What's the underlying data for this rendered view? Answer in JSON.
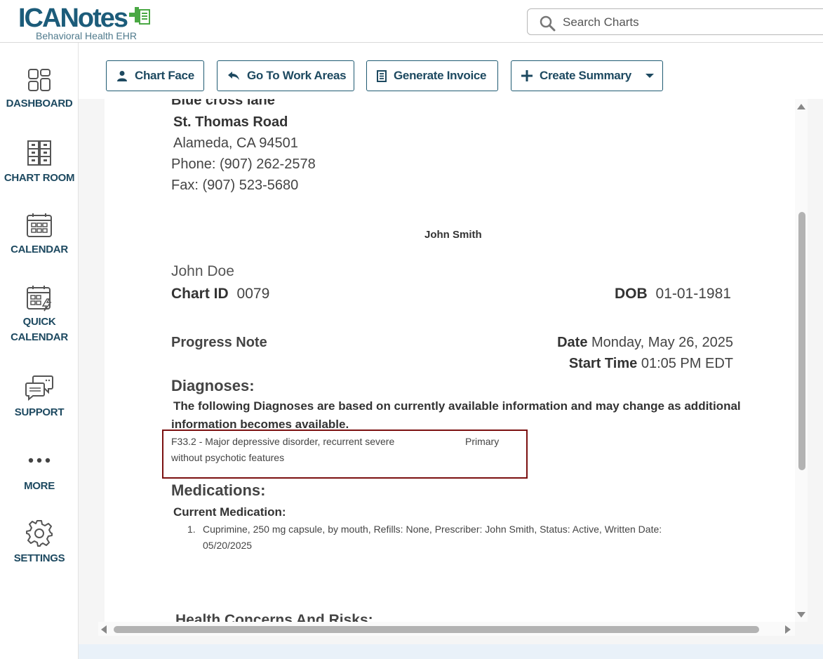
{
  "header": {
    "logo_main": "ICANotes",
    "logo_sub": "Behavioral Health EHR",
    "search_placeholder": "Search Charts"
  },
  "sidebar": {
    "items": [
      {
        "label": "DASHBOARD",
        "icon": "dashboard-icon"
      },
      {
        "label": "CHART ROOM",
        "icon": "chart-room-icon"
      },
      {
        "label": "CALENDAR",
        "icon": "calendar-icon"
      },
      {
        "label": "QUICK",
        "label2": "CALENDAR",
        "icon": "quick-calendar-icon"
      },
      {
        "label": "SUPPORT",
        "icon": "support-icon"
      },
      {
        "label": "MORE",
        "icon": "more-icon"
      },
      {
        "label": "SETTINGS",
        "icon": "gear-icon"
      }
    ]
  },
  "toolbar": {
    "chart_face": "Chart Face",
    "go_to_work_areas": "Go To Work Areas",
    "generate_invoice": "Generate Invoice",
    "create_summary": "Create Summary"
  },
  "document": {
    "clinic_name_partial": "Blue cross lane",
    "address_line1": "St. Thomas Road",
    "address_line2": "Alameda, CA 94501",
    "phone": "Phone: (907) 262-2578",
    "fax": "Fax: (907) 523-5680",
    "provider_name": "John Smith",
    "patient_name": "John Doe",
    "chart_id_label": "Chart ID",
    "chart_id": "0079",
    "dob_label": "DOB",
    "dob": "01-01-1981",
    "note_type": "Progress Note",
    "date_label": "Date",
    "date_value": "Monday, May 26, 2025",
    "start_time_label": "Start Time",
    "start_time_value": "01:05 PM EDT",
    "diagnoses_heading": "Diagnoses:",
    "diagnoses_intro_line1": "The following Diagnoses are based on currently available information and may change as additional",
    "diagnoses_intro_line2": "information becomes available.",
    "diagnosis_line1": "F33.2 - Major depressive disorder, recurrent severe",
    "diagnosis_line2": "without psychotic features",
    "diagnosis_rank": "Primary",
    "medications_heading": "Medications:",
    "current_medication_label": "Current Medication:",
    "med_number": "1.",
    "med_line1": "Cuprimine, 250 mg capsule, by mouth, Refills: None,  Prescriber: John Smith, Status: Active, Written Date:",
    "med_line2": "05/20/2025",
    "health_concerns_heading": "Health Concerns And Risks:"
  },
  "colors": {
    "brand_blue": "#1d4960",
    "brand_green": "#4aa844",
    "highlight_border": "#7b1010"
  }
}
